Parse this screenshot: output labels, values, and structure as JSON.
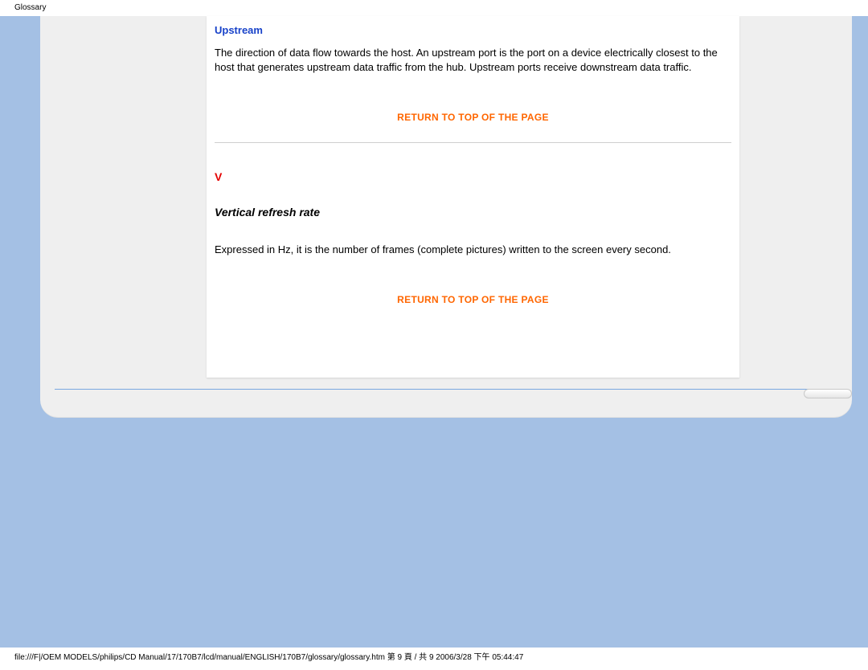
{
  "header": {
    "label": "Glossary"
  },
  "card": {
    "term1": {
      "title": "Upstream",
      "body": "The direction of data flow towards the host. An upstream port is the port on a device electrically closest to the host that generates upstream data traffic from the hub. Upstream ports receive downstream data traffic."
    },
    "return_label": "RETURN TO TOP OF THE PAGE",
    "letter_v": "V",
    "term2": {
      "title": "Vertical refresh rate",
      "body": "Expressed in Hz, it is the number of frames (complete pictures) written to the screen every second."
    }
  },
  "footer": {
    "path": "file:///F|/OEM MODELS/philips/CD Manual/17/170B7/lcd/manual/ENGLISH/170B7/glossary/glossary.htm 第 9 頁 / 共 9 2006/3/28 下午 05:44:47"
  }
}
